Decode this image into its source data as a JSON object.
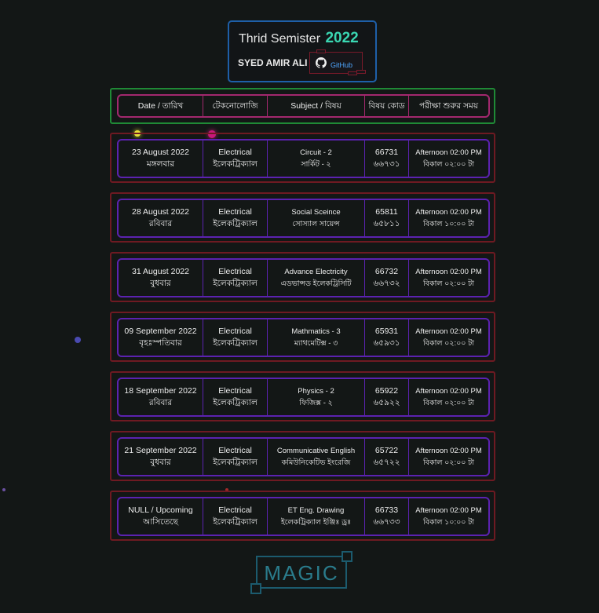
{
  "header": {
    "title": "Thrid Semister",
    "year": "2022",
    "author": "SYED AMIR ALI",
    "github_label": "GitHub"
  },
  "columns": [
    "Date / তারিখ",
    "টেকনোলোজি",
    "Subject / বিষয়",
    "বিষয় কোড",
    "পরীক্ষা শুরুর সময়"
  ],
  "rows": [
    {
      "date": "23 August 2022",
      "day": "মঙ্গলবার",
      "tech_en": "Electrical",
      "tech_bn": "ইলেকট্রিক্যাল",
      "subj_en": "Circuit - 2",
      "subj_bn": "সার্কিট - ২",
      "code_en": "66731",
      "code_bn": "৬৬৭৩১",
      "time_en": "Afternoon 02:00 PM",
      "time_bn": "বিকাল ০২:০০ টা"
    },
    {
      "date": "28 August 2022",
      "day": "রবিবার",
      "tech_en": "Electrical",
      "tech_bn": "ইলেকট্রিক্যাল",
      "subj_en": "Social Sceince",
      "subj_bn": "সোস্যাল সায়েন্স",
      "code_en": "65811",
      "code_bn": "৬৫৮১১",
      "time_en": "Afternoon 02:00 PM",
      "time_bn": "বিকাল ১০:০০ টা"
    },
    {
      "date": "31 August 2022",
      "day": "বুধবার",
      "tech_en": "Electrical",
      "tech_bn": "ইলেকট্রিক্যাল",
      "subj_en": "Advance Electricity",
      "subj_bn": "এডভান্সড ইলেকট্রিসিটি",
      "code_en": "66732",
      "code_bn": "৬৬৭৩২",
      "time_en": "Afternoon 02:00 PM",
      "time_bn": "বিকাল ০২:০০ টা"
    },
    {
      "date": "09 September 2022",
      "day": "বৃহঃস্পতিবার",
      "tech_en": "Electrical",
      "tech_bn": "ইলেকট্রিক্যাল",
      "subj_en": "Mathmatics - 3",
      "subj_bn": "ম্যাথমেটিক্স - ৩",
      "code_en": "65931",
      "code_bn": "৬৫৯৩১",
      "time_en": "Afternoon 02:00 PM",
      "time_bn": "বিকাল ০২:০০ টা"
    },
    {
      "date": "18 September 2022",
      "day": "রবিবার",
      "tech_en": "Electrical",
      "tech_bn": "ইলেকট্রিক্যাল",
      "subj_en": "Physics - 2",
      "subj_bn": "ফিজিক্স - ২",
      "code_en": "65922",
      "code_bn": "৬৫৯২২",
      "time_en": "Afternoon 02:00 PM",
      "time_bn": "বিকাল ০২:০০ টা"
    },
    {
      "date": "21 September 2022",
      "day": "বুধবার",
      "tech_en": "Electrical",
      "tech_bn": "ইলেকট্রিক্যাল",
      "subj_en": "Communicative English",
      "subj_bn": "কমিউনিকেটিভ ইংরেজি",
      "code_en": "65722",
      "code_bn": "৬৫৭২২",
      "time_en": "Afternoon 02:00 PM",
      "time_bn": "বিকাল ০২:০০ টা"
    },
    {
      "date": "NULL / Upcoming",
      "day": "আসিতেছে",
      "tech_en": "Electrical",
      "tech_bn": "ইলেকট্রিক্যাল",
      "subj_en": "ET Eng. Drawing",
      "subj_bn": "ইলেকট্রিক্যাল ইঞ্জিঃ ড্রঃ",
      "code_en": "66733",
      "code_bn": "৬৬৭৩৩",
      "time_en": "Afternoon 02:00 PM",
      "time_bn": "বিকাল ১০:০০ টা"
    }
  ],
  "logo": "MAGIC",
  "colors": {
    "accent": "#3ad7b2",
    "header_border": "#1e5fa8",
    "row_outer": "#6e1a22",
    "row_inner": "#5b22b0",
    "head_outer": "#1f8a36",
    "head_inner": "#a3286e"
  }
}
